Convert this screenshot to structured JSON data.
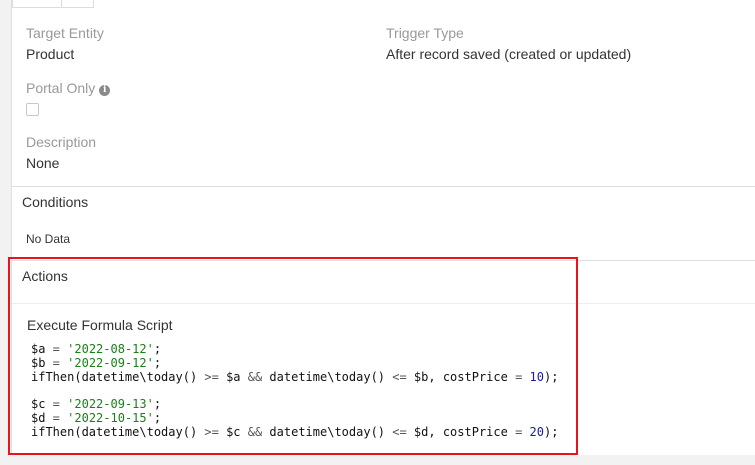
{
  "details": {
    "target_entity": {
      "label": "Target Entity",
      "value": "Product"
    },
    "trigger_type": {
      "label": "Trigger Type",
      "value": "After record saved (created or updated)"
    },
    "portal_only": {
      "label": "Portal Only",
      "info_icon": "info-circle-icon",
      "checked": false
    },
    "description": {
      "label": "Description",
      "value": "None"
    }
  },
  "conditions": {
    "title": "Conditions",
    "empty_text": "No Data"
  },
  "actions": {
    "title": "Actions",
    "items": [
      {
        "type_label": "Execute Formula Script",
        "code_lines": [
          [
            {
              "t": "var",
              "v": "$a"
            },
            {
              "t": "op",
              "v": " = "
            },
            {
              "t": "str",
              "v": "'2022-08-12'"
            },
            {
              "t": "var",
              "v": ";"
            }
          ],
          [
            {
              "t": "var",
              "v": "$b"
            },
            {
              "t": "op",
              "v": " = "
            },
            {
              "t": "str",
              "v": "'2022-09-12'"
            },
            {
              "t": "var",
              "v": ";"
            }
          ],
          [
            {
              "t": "var",
              "v": "ifThen(datetime\\today() "
            },
            {
              "t": "op",
              "v": ">="
            },
            {
              "t": "var",
              "v": " $a "
            },
            {
              "t": "op",
              "v": "&&"
            },
            {
              "t": "var",
              "v": " datetime\\today() "
            },
            {
              "t": "op",
              "v": "<="
            },
            {
              "t": "var",
              "v": " $b, costPrice "
            },
            {
              "t": "op",
              "v": "="
            },
            {
              "t": "var",
              "v": " "
            },
            {
              "t": "num",
              "v": "10"
            },
            {
              "t": "var",
              "v": ");"
            }
          ],
          [],
          [
            {
              "t": "var",
              "v": "$c"
            },
            {
              "t": "op",
              "v": " = "
            },
            {
              "t": "str",
              "v": "'2022-09-13'"
            },
            {
              "t": "var",
              "v": ";"
            }
          ],
          [
            {
              "t": "var",
              "v": "$d"
            },
            {
              "t": "op",
              "v": " = "
            },
            {
              "t": "str",
              "v": "'2022-10-15'"
            },
            {
              "t": "var",
              "v": ";"
            }
          ],
          [
            {
              "t": "var",
              "v": "ifThen(datetime\\today() "
            },
            {
              "t": "op",
              "v": ">="
            },
            {
              "t": "var",
              "v": " $c "
            },
            {
              "t": "op",
              "v": "&&"
            },
            {
              "t": "var",
              "v": " datetime\\today() "
            },
            {
              "t": "op",
              "v": "<="
            },
            {
              "t": "var",
              "v": " $d, costPrice "
            },
            {
              "t": "op",
              "v": "="
            },
            {
              "t": "var",
              "v": " "
            },
            {
              "t": "num",
              "v": "20"
            },
            {
              "t": "var",
              "v": ");"
            }
          ]
        ]
      }
    ]
  },
  "colors": {
    "highlight_border": "#e8141b",
    "string_token": "#1a7f1a",
    "number_token": "#1a1aa6"
  }
}
